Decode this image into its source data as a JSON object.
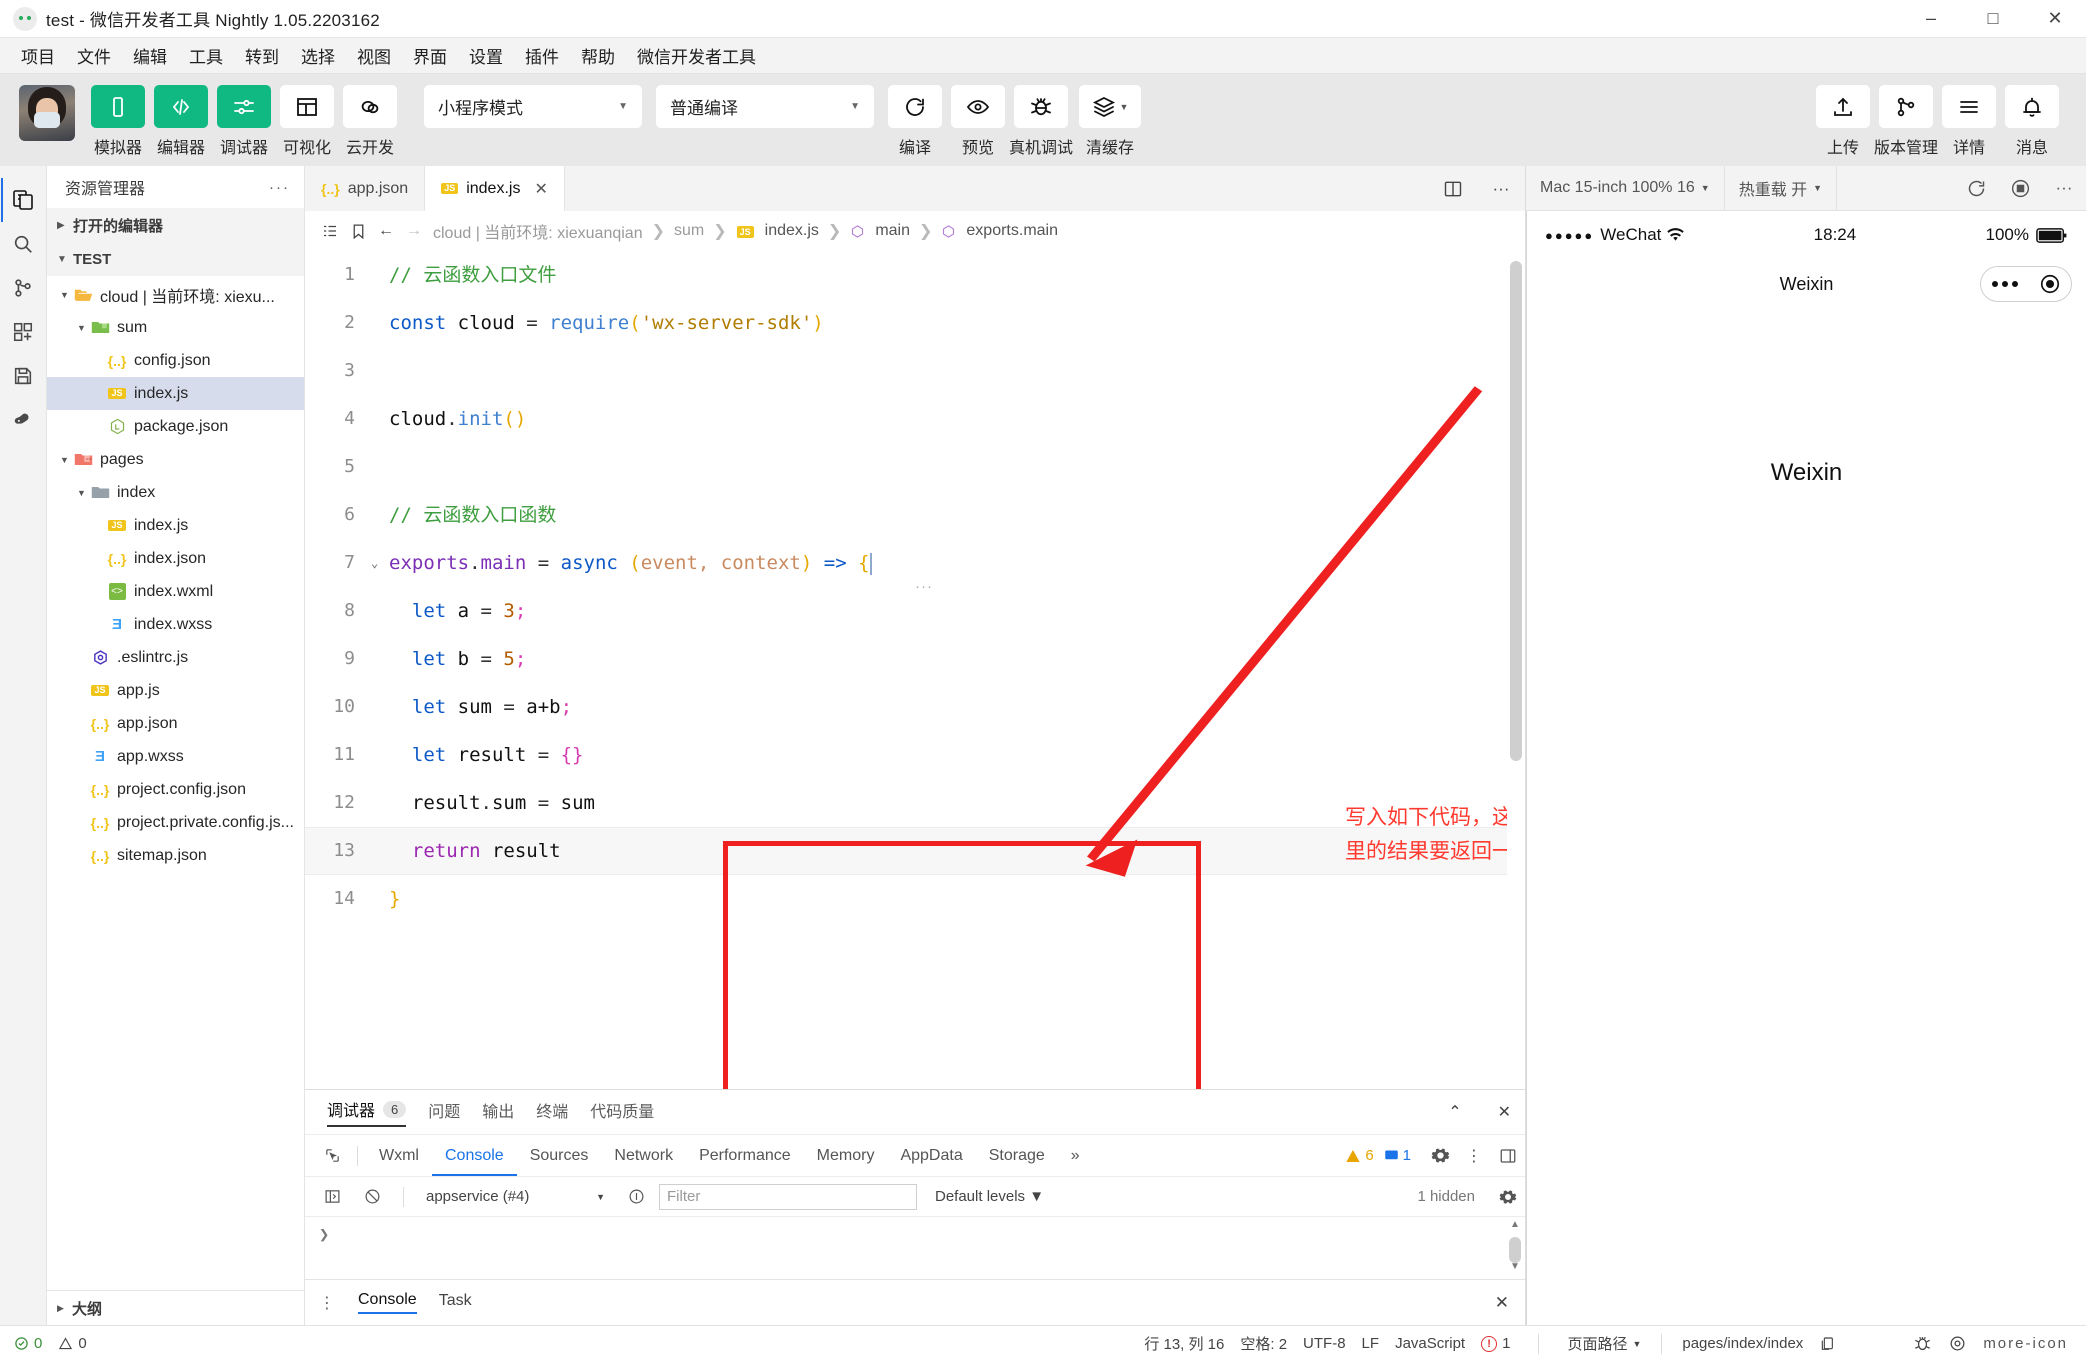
{
  "window": {
    "title": "test - 微信开发者工具 Nightly 1.05.2203162",
    "minimize": "–",
    "maximize": "□",
    "close": "✕"
  },
  "menubar": {
    "items": [
      "项目",
      "文件",
      "编辑",
      "工具",
      "转到",
      "选择",
      "视图",
      "界面",
      "设置",
      "插件",
      "帮助",
      "微信开发者工具"
    ]
  },
  "toolbar": {
    "left_buttons": [
      {
        "label": "模拟器",
        "icon": "phone-icon",
        "style": "green"
      },
      {
        "label": "编辑器",
        "icon": "code-icon",
        "style": "green"
      },
      {
        "label": "调试器",
        "icon": "sliders-icon",
        "style": "green"
      },
      {
        "label": "可视化",
        "icon": "layout-icon",
        "style": "white"
      },
      {
        "label": "云开发",
        "icon": "cloud-rings-icon",
        "style": "white"
      }
    ],
    "mode_select": "小程序模式",
    "compile_select": "普通编译",
    "action_buttons": [
      {
        "label": "编译",
        "icon": "refresh-icon"
      },
      {
        "label": "预览",
        "icon": "eye-icon"
      },
      {
        "label": "真机调试",
        "icon": "bug-icon"
      },
      {
        "label": "清缓存",
        "icon": "layers-icon"
      }
    ],
    "right_buttons": [
      {
        "label": "上传",
        "icon": "upload-icon"
      },
      {
        "label": "版本管理",
        "icon": "branch-icon"
      },
      {
        "label": "详情",
        "icon": "menu-icon"
      },
      {
        "label": "消息",
        "icon": "bell-icon"
      }
    ]
  },
  "activity_bar": {
    "items": [
      "files-icon",
      "search-icon",
      "source-control-icon",
      "extensions-icon",
      "save-icon",
      "plugin-icon"
    ]
  },
  "explorer": {
    "title": "资源管理器",
    "more": "···",
    "open_editors": "打开的编辑器",
    "root": "TEST",
    "outline": "大纲",
    "tree": [
      {
        "label": "cloud | 当前环境: xiexu...",
        "indent": 1,
        "icon": "folder-open-orange",
        "arrow": "▼"
      },
      {
        "label": "sum",
        "indent": 2,
        "icon": "folder-green",
        "arrow": "▼"
      },
      {
        "label": "config.json",
        "indent": 3,
        "icon": "json"
      },
      {
        "label": "index.js",
        "indent": 3,
        "icon": "js",
        "selected": true
      },
      {
        "label": "package.json",
        "indent": 3,
        "icon": "node"
      },
      {
        "label": "pages",
        "indent": 1,
        "icon": "folder-red",
        "arrow": "▼"
      },
      {
        "label": "index",
        "indent": 2,
        "icon": "folder-grey",
        "arrow": "▼"
      },
      {
        "label": "index.js",
        "indent": 3,
        "icon": "js"
      },
      {
        "label": "index.json",
        "indent": 3,
        "icon": "json"
      },
      {
        "label": "index.wxml",
        "indent": 3,
        "icon": "wxml"
      },
      {
        "label": "index.wxss",
        "indent": 3,
        "icon": "wxss"
      },
      {
        "label": ".eslintrc.js",
        "indent": 2,
        "icon": "eslint"
      },
      {
        "label": "app.js",
        "indent": 2,
        "icon": "js"
      },
      {
        "label": "app.json",
        "indent": 2,
        "icon": "json"
      },
      {
        "label": "app.wxss",
        "indent": 2,
        "icon": "wxss"
      },
      {
        "label": "project.config.json",
        "indent": 2,
        "icon": "json"
      },
      {
        "label": "project.private.config.js...",
        "indent": 2,
        "icon": "json"
      },
      {
        "label": "sitemap.json",
        "indent": 2,
        "icon": "json"
      }
    ]
  },
  "editor": {
    "tabs": [
      {
        "label": "app.json",
        "icon": "json",
        "active": false
      },
      {
        "label": "index.js",
        "icon": "js",
        "active": true,
        "close": "✕"
      }
    ],
    "split_icon": "split-editor-icon",
    "more_icon": "more-icon",
    "breadcrumb": [
      "cloud | 当前环境: xiexuanqian",
      "sum",
      "index.js",
      "main",
      "exports.main"
    ],
    "breadcrumb_sep": "❯",
    "lines": [
      {
        "n": "1",
        "parts": [
          {
            "t": "// 云函数入口文件",
            "c": "c-com"
          }
        ]
      },
      {
        "n": "2",
        "parts": [
          {
            "t": "const ",
            "c": "c-kw"
          },
          {
            "t": "cloud ",
            "c": "c-var"
          },
          {
            "t": "= ",
            "c": "c-pun"
          },
          {
            "t": "require",
            "c": "c-fn"
          },
          {
            "t": "(",
            "c": "c-par"
          },
          {
            "t": "'wx-server-sdk'",
            "c": "c-str"
          },
          {
            "t": ")",
            "c": "c-par"
          }
        ]
      },
      {
        "n": "3",
        "parts": []
      },
      {
        "n": "4",
        "parts": [
          {
            "t": "cloud",
            "c": "c-var"
          },
          {
            "t": ".",
            "c": "c-pun"
          },
          {
            "t": "init",
            "c": "c-fn"
          },
          {
            "t": "()",
            "c": "c-par"
          }
        ]
      },
      {
        "n": "5",
        "parts": []
      },
      {
        "n": "6",
        "parts": [
          {
            "t": "// 云函数入口函数",
            "c": "c-com"
          }
        ]
      },
      {
        "n": "7",
        "fold": "⌄",
        "parts": [
          {
            "t": "exports",
            "c": "c-prop"
          },
          {
            "t": ".",
            "c": "c-pun"
          },
          {
            "t": "main ",
            "c": "c-prop"
          },
          {
            "t": "= ",
            "c": "c-pun"
          },
          {
            "t": "async ",
            "c": "c-kw"
          },
          {
            "t": "(",
            "c": "c-par"
          },
          {
            "t": "event, context",
            "c": "c-param"
          },
          {
            "t": ") ",
            "c": "c-par"
          },
          {
            "t": "=> ",
            "c": "c-kw"
          },
          {
            "t": "{",
            "c": "c-par"
          }
        ]
      },
      {
        "n": "8",
        "parts": [
          {
            "t": "  let ",
            "c": "c-kw"
          },
          {
            "t": "a ",
            "c": "c-var"
          },
          {
            "t": "= ",
            "c": "c-pun"
          },
          {
            "t": "3",
            "c": "c-num"
          },
          {
            "t": ";",
            "c": "c-brace"
          }
        ]
      },
      {
        "n": "9",
        "parts": [
          {
            "t": "  let ",
            "c": "c-kw"
          },
          {
            "t": "b ",
            "c": "c-var"
          },
          {
            "t": "= ",
            "c": "c-pun"
          },
          {
            "t": "5",
            "c": "c-num"
          },
          {
            "t": ";",
            "c": "c-brace"
          }
        ]
      },
      {
        "n": "10",
        "parts": [
          {
            "t": "  let ",
            "c": "c-kw"
          },
          {
            "t": "sum ",
            "c": "c-var"
          },
          {
            "t": "= ",
            "c": "c-pun"
          },
          {
            "t": "a+b",
            "c": "c-var"
          },
          {
            "t": ";",
            "c": "c-brace"
          }
        ]
      },
      {
        "n": "11",
        "parts": [
          {
            "t": "  let ",
            "c": "c-kw"
          },
          {
            "t": "result ",
            "c": "c-var"
          },
          {
            "t": "= ",
            "c": "c-pun"
          },
          {
            "t": "{}",
            "c": "c-brace"
          }
        ]
      },
      {
        "n": "12",
        "parts": [
          {
            "t": "  result",
            "c": "c-var"
          },
          {
            "t": ".",
            "c": "c-pun"
          },
          {
            "t": "sum ",
            "c": "c-var"
          },
          {
            "t": "= ",
            "c": "c-pun"
          },
          {
            "t": "sum",
            "c": "c-var"
          }
        ]
      },
      {
        "n": "13",
        "hl": true,
        "parts": [
          {
            "t": "  return ",
            "c": "c-kw2"
          },
          {
            "t": "result",
            "c": "c-var"
          }
        ]
      },
      {
        "n": "14",
        "parts": [
          {
            "t": "}",
            "c": "c-par"
          }
        ]
      }
    ],
    "inline_ellipsis": "···",
    "annotation": {
      "text": "写入如下代码，这里是逻辑代码，作用和普通函数无异，只不过这里的结果要返回一个JSON对象",
      "color": "#ff3b30"
    }
  },
  "devtools": {
    "panel_tabs": [
      {
        "label": "调试器",
        "count": "6",
        "active": true
      },
      {
        "label": "问题",
        "active": false
      },
      {
        "label": "输出",
        "active": false
      },
      {
        "label": "终端",
        "active": false
      },
      {
        "label": "代码质量",
        "active": false
      }
    ],
    "collapse_icon": "chevron-up-icon",
    "close_icon": "close-icon",
    "inspector_tabs": [
      "Wxml",
      "Console",
      "Sources",
      "Network",
      "Performance",
      "Memory",
      "AppData",
      "Storage"
    ],
    "inspector_active": "Console",
    "overflow": "»",
    "warning_count": "6",
    "info_count": "1",
    "settings_icon": "gear-icon",
    "kebab_icon": "kebab-icon",
    "dock_icon": "dock-icon",
    "console_context": "appservice (#4)",
    "filter_placeholder": "Filter",
    "levels": "Default levels",
    "hidden": "1 hidden",
    "prompt": "❯",
    "footer_tabs": [
      {
        "label": "Console",
        "active": true
      },
      {
        "label": "Task",
        "active": false
      }
    ]
  },
  "simulator": {
    "device": "Mac 15-inch 100% 16",
    "hot_reload": "热重载 开",
    "refresh_icon": "refresh-icon",
    "record_icon": "record-icon",
    "more_icon": "more-icon",
    "carrier": "WeChat",
    "signal_dots": "●●●●●",
    "time": "18:24",
    "battery": "100%",
    "nav_title": "Weixin",
    "page_text": "Weixin"
  },
  "statusbar": {
    "errors": "0",
    "warnings": "0",
    "cursor": "行 13, 列 16",
    "spaces": "空格: 2",
    "encoding": "UTF-8",
    "eol": "LF",
    "language": "JavaScript",
    "problem_count": "1",
    "page_path_label": "页面路径",
    "page_path": "pages/index/index",
    "copy_icon": "copy-icon",
    "bug_icon": "bug-icon",
    "eye_icon": "eye-icon",
    "more_icon": "more-icon"
  }
}
